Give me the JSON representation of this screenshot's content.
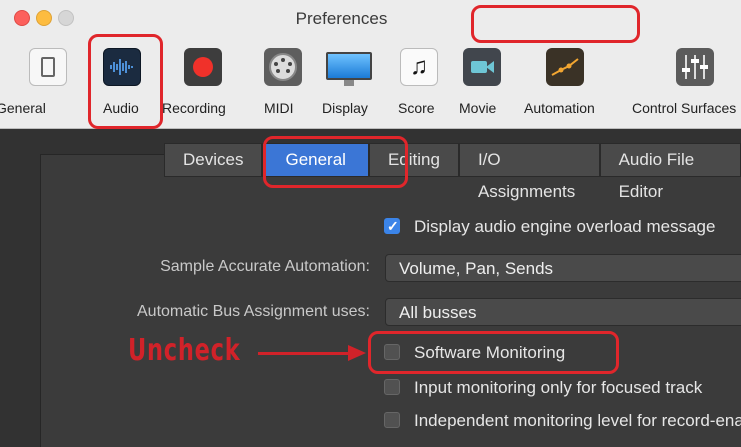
{
  "window": {
    "title": "Preferences"
  },
  "toolbar": {
    "items": [
      {
        "label": "General",
        "icon": "general-icon"
      },
      {
        "label": "Audio",
        "icon": "audio-waveform-icon"
      },
      {
        "label": "Recording",
        "icon": "record-icon"
      },
      {
        "label": "MIDI",
        "icon": "midi-connector-icon"
      },
      {
        "label": "Display",
        "icon": "display-monitor-icon"
      },
      {
        "label": "Score",
        "icon": "music-note-icon"
      },
      {
        "label": "Movie",
        "icon": "movie-camera-icon"
      },
      {
        "label": "Automation",
        "icon": "automation-curve-icon"
      },
      {
        "label": "Control Surfaces",
        "icon": "mixer-faders-icon"
      }
    ],
    "selected": "Audio"
  },
  "tabs": [
    {
      "label": "Devices"
    },
    {
      "label": "General"
    },
    {
      "label": "Editing"
    },
    {
      "label": "I/O Assignments"
    },
    {
      "label": "Audio File Editor"
    }
  ],
  "active_tab": "General",
  "settings": {
    "overload_message": {
      "label": "Display audio engine overload message",
      "checked": true
    },
    "sample_accurate": {
      "label": "Sample Accurate Automation:",
      "value": "Volume, Pan, Sends"
    },
    "bus_assignment": {
      "label": "Automatic Bus Assignment uses:",
      "value": "All busses"
    },
    "software_monitoring": {
      "label": "Software Monitoring",
      "checked": false
    },
    "input_monitoring": {
      "label": "Input monitoring only for focused track",
      "checked": false
    },
    "independent_monitoring": {
      "label": "Independent monitoring level for record-enabled channel strips",
      "checked": false
    }
  },
  "annotation": {
    "text": "Uncheck",
    "color": "#d12229"
  },
  "colors": {
    "accent": "#3b76d6",
    "highlight": "#e0262b"
  }
}
